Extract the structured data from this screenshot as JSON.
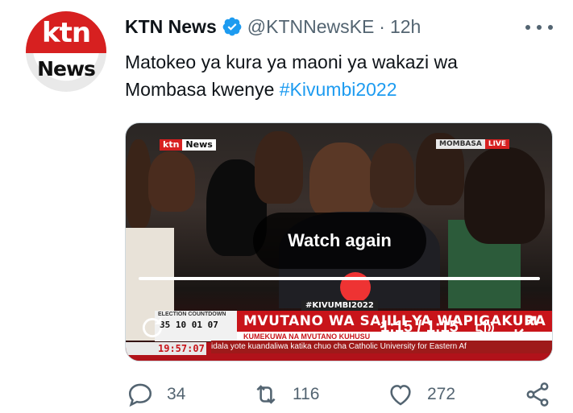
{
  "avatar": {
    "line1": "ktn",
    "line2": "News"
  },
  "tweet": {
    "display_name": "KTN News",
    "handle": "@KTNNewsKE",
    "separator": "·",
    "time": "12h",
    "text_part1": "Matokeo ya kura ya maoni ya wakazi wa",
    "text_part2": "Mombasa kwenye ",
    "hashtag": "#Kivumbi2022"
  },
  "video": {
    "channel_logo_k": "ktn",
    "channel_logo_n": "News",
    "location": "MOMBASA",
    "live": "LIVE",
    "watch_again": "Watch again",
    "progress": 1.0,
    "time_readout": "1:15 / 1:15",
    "ticker_tag": "#KIVUMBI2022",
    "headline": "MVUTANO WA SAJILI YA WAPIGAKURA",
    "subline": "KUMEKUWA NA MVUTANO KUHUSU",
    "countdown_label": "ELECTION COUNTDOWN",
    "countdown_value": "35 10 01 07",
    "clock": "19:57:07",
    "scroll_text": "idala yote kuandaliwa katika chuo cha Catholic University for Eastern Af"
  },
  "actions": {
    "replies": "34",
    "retweets": "116",
    "likes": "272"
  },
  "colors": {
    "accent": "#1d9bf0",
    "secondary_text": "#536471",
    "brand_red": "#d72020"
  }
}
